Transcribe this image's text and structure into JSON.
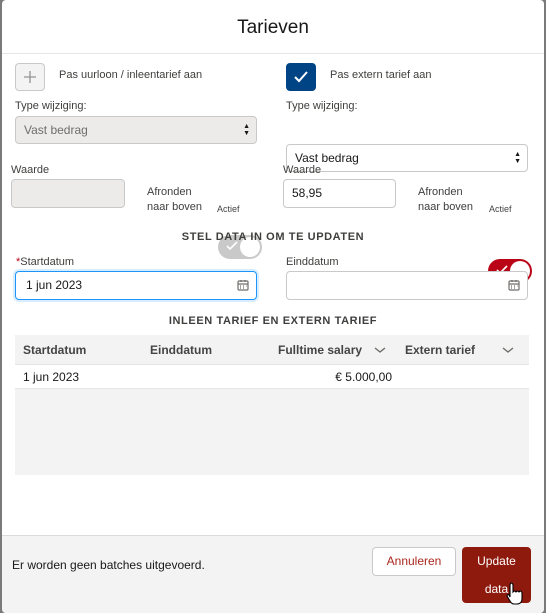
{
  "dialog": {
    "title": "Tarieven"
  },
  "left": {
    "checkbox_label": "Pas uurloon / inleentarief aan",
    "checked": false,
    "type_label": "Type wijziging:",
    "type_value": "Vast bedrag",
    "waarde_label": "Waarde",
    "waarde_value": "",
    "afronden_label_1": "Afronden",
    "afronden_label_2": "naar boven",
    "switch_label": "Actief",
    "switch_on": false
  },
  "right": {
    "checkbox_label": "Pas extern tarief aan",
    "checked": true,
    "type_label": "Type wijziging:",
    "type_value": "Vast bedrag",
    "waarde_label": "Waarde",
    "waarde_value": "58,95",
    "afronden_label_1": "Afronden",
    "afronden_label_2": "naar boven",
    "switch_label": "Actief",
    "switch_on": true
  },
  "dates": {
    "section_title": "STEL DATA IN OM TE UPDATEN",
    "required_marker": "*",
    "start_label": "Startdatum",
    "start_value": "1 jun 2023",
    "end_label": "Einddatum",
    "end_value": ""
  },
  "table": {
    "section_title": "INLEEN TARIEF EN EXTERN TARIEF",
    "columns": [
      "Startdatum",
      "Einddatum",
      "Fulltime salary",
      "Extern tarief"
    ],
    "rows": [
      {
        "startdatum": "1 jun 2023",
        "einddatum": "",
        "fulltime_salary": "€ 5.000,00",
        "extern_tarief": ""
      }
    ]
  },
  "footer": {
    "status": "Er worden geen batches uitgevoerd.",
    "cancel_label": "Annuleren",
    "update_label_1": "Update",
    "update_label_2": "data"
  },
  "colors": {
    "brand_blue": "#014486",
    "accent_red": "#ba0517",
    "button_red": "#8e1a0d"
  }
}
